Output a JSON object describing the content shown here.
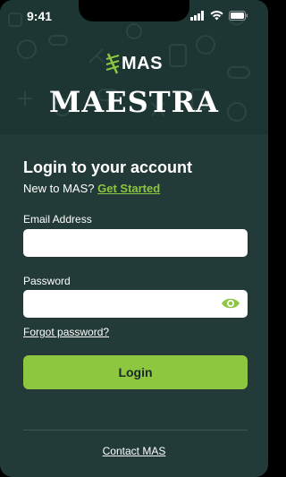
{
  "status_bar": {
    "time": "9:41"
  },
  "brand": {
    "logo_text": "MAS",
    "name": "MAESTRA"
  },
  "login": {
    "title": "Login to your account",
    "new_prompt": "New to MAS?",
    "get_started": "Get Started",
    "email_label": "Email Address",
    "email_value": "",
    "password_label": "Password",
    "password_value": "",
    "forgot": "Forgot password?",
    "submit": "Login"
  },
  "footer": {
    "contact": "Contact MAS"
  },
  "colors": {
    "background": "#1c3331",
    "accent": "#8dc63f",
    "panel": "#223a38"
  },
  "icons": [
    "wifi-icon",
    "signal-icon",
    "battery-icon",
    "eye-icon",
    "mas-logo-icon"
  ]
}
